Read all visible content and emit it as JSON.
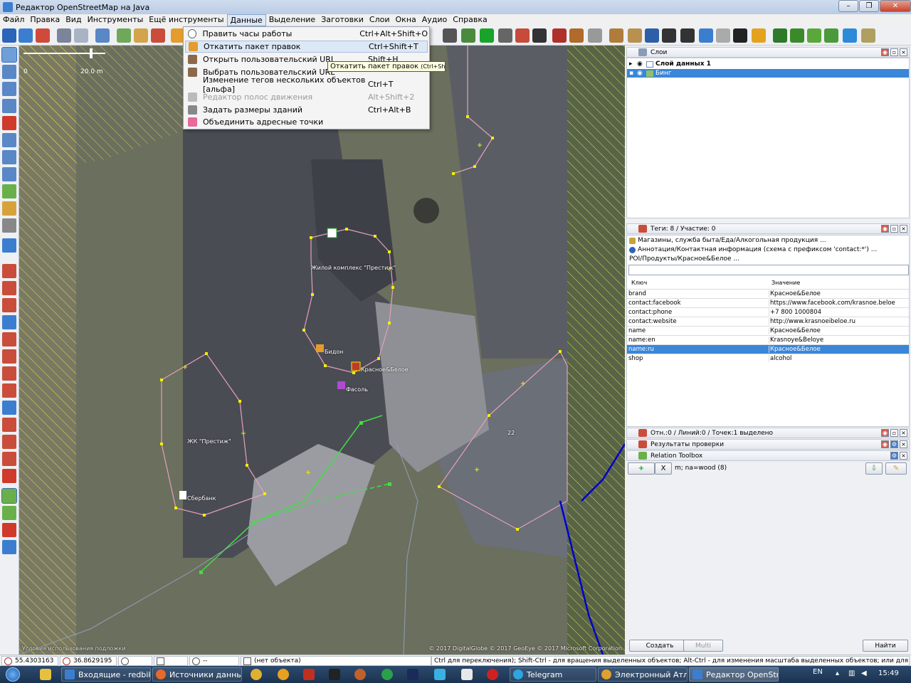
{
  "window": {
    "title": "Редактор OpenStreetMap на Java",
    "minimize": "–",
    "restore": "❐",
    "close": "✕"
  },
  "menubar": [
    "Файл",
    "Правка",
    "Вид",
    "Инструменты",
    "Ещё инструменты",
    "Данные",
    "Выделение",
    "Заготовки",
    "Слои",
    "Окна",
    "Аудио",
    "Справка"
  ],
  "active_menu": "Данные",
  "dropdown": [
    {
      "label": "Править часы работы",
      "shortcut": "Ctrl+Alt+Shift+O",
      "icon": "clock-icon",
      "disabled": false
    },
    {
      "label": "Откатить пакет правок",
      "shortcut": "Ctrl+Shift+T",
      "icon": "revert-changeset-icon",
      "disabled": false
    },
    {
      "label": "Открыть пользовательский URL",
      "shortcut": "Shift+H",
      "icon": "open-url-icon",
      "disabled": false
    },
    {
      "label": "Выбрать пользовательский URL",
      "shortcut": "",
      "icon": "choose-url-icon",
      "disabled": false
    },
    {
      "label": "Изменение тегов нескольких объектов [альфа]",
      "shortcut": "Ctrl+T",
      "icon": "",
      "disabled": false
    },
    {
      "label": "Редактор полос движения",
      "shortcut": "Alt+Shift+2",
      "icon": "lanes-icon",
      "disabled": true
    },
    {
      "label": "Задать размеры зданий",
      "shortcut": "Ctrl+Alt+B",
      "icon": "building-size-icon",
      "disabled": false
    },
    {
      "label": "Объединить адресные точки",
      "shortcut": "",
      "icon": "merge-address-icon",
      "disabled": false
    }
  ],
  "tooltip": {
    "text": "Откатить пакет правок",
    "shortcut": "(Ctrl+Shift+T)"
  },
  "map": {
    "scale_start": "0",
    "scale_end": "20.0 m",
    "labels": {
      "complex": "Жилой комплекс \"Престиж\"",
      "complex2": "ЖК \"Престиж\"",
      "store": "Красное&Белое",
      "bidon": "Бидон",
      "fasol": "Фасоль",
      "sber": "Сбербанк",
      "num": "22"
    },
    "attribution": "© 2017 DigitalGlobe © 2017 GeoEye © 2017 Microsoft Corporation",
    "attribution_left": "Условия использования подложки"
  },
  "layers": {
    "title": "Слои",
    "items": [
      {
        "name": "Слой данных 1",
        "bold": true,
        "selected": false
      },
      {
        "name": "Бинг",
        "bold": false,
        "selected": true
      }
    ]
  },
  "tags": {
    "title": "Теги: 8 / Участие: 0",
    "presets": [
      "Магазины, служба быта/Еда/Алкогольная продукция ...",
      "Аннотация/Контактная информация (схема с префиксом 'contact:*') ...",
      "POI/Продукты/Красное&Белое ..."
    ],
    "header_key": "Ключ",
    "header_value": "Значение",
    "rows": [
      {
        "key": "brand",
        "value": "Красное&Белое"
      },
      {
        "key": "contact:facebook",
        "value": "https://www.facebook.com/krasnoe.beloe"
      },
      {
        "key": "contact:phone",
        "value": "+7 800 1000804"
      },
      {
        "key": "contact:website",
        "value": "http://www.krasnoeibeloe.ru"
      },
      {
        "key": "name",
        "value": "Красное&Белое"
      },
      {
        "key": "name:en",
        "value": "Krasnoye&Beloye"
      },
      {
        "key": "name:ru",
        "value": "Красное&Белое"
      },
      {
        "key": "shop",
        "value": "alcohol"
      }
    ],
    "selected_row": 6
  },
  "panels": {
    "selection": "Отн.:0 / Линий:0 / Точек:1 выделено",
    "validation": "Результаты проверки",
    "relation_toolbox": "Relation Toolbox"
  },
  "relation_toolbox": {
    "add": "+",
    "clear": "X",
    "condition": "m; na=wood (8)"
  },
  "bottom_buttons": {
    "create": "Создать",
    "multi": "Multi",
    "find": "Найти"
  },
  "status": {
    "lat": "55.4303163",
    "lon": "36.8629195",
    "heading": "",
    "angle": "",
    "distance": "--",
    "object": "(нет объекта)",
    "help": "Ctrl для переключения); Shift-Ctrl - для вращения выделенных объектов; Alt-Ctrl - для изменения масштаба выделенных объектов; или для изменения выделения"
  },
  "taskbar": {
    "tasks": [
      {
        "label": "Входящие - redbik...",
        "active": false
      },
      {
        "label": "Источники данных...",
        "active": false
      },
      {
        "label": "Telegram",
        "active": false
      },
      {
        "label": "Электронный Атла...",
        "active": false
      },
      {
        "label": "Редактор OpenStr...",
        "active": true
      }
    ],
    "lang": "EN",
    "time": "15:49"
  },
  "colors": {
    "accent": "#3a86d8",
    "way_pink": "#e6a0b8",
    "node_yellow": "#f0f000",
    "selected_green": "#40e040",
    "relation_blue": "#0000cc"
  }
}
